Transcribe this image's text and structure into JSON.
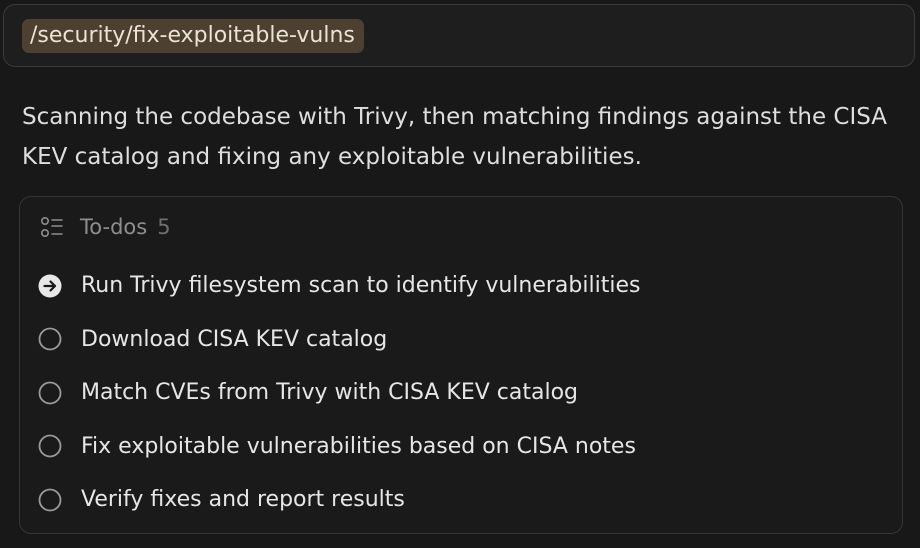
{
  "command": {
    "text": "/security/fix-exploitable-vulns"
  },
  "message": {
    "text": "Scanning the codebase with Trivy, then matching findings against the CISA KEV catalog and fixing any exploitable vulnerabilities."
  },
  "todos": {
    "title": "To-dos",
    "count": "5",
    "header_icon": "list-icon",
    "items": [
      {
        "label": "Run Trivy filesystem scan to identify vulnerabilities",
        "status": "in-progress",
        "icon": "arrow-right-circle-icon"
      },
      {
        "label": "Download CISA KEV catalog",
        "status": "pending",
        "icon": "empty-circle-icon"
      },
      {
        "label": "Match CVEs from Trivy with CISA KEV catalog",
        "status": "pending",
        "icon": "empty-circle-icon"
      },
      {
        "label": "Fix exploitable vulnerabilities based on CISA notes",
        "status": "pending",
        "icon": "empty-circle-icon"
      },
      {
        "label": "Verify fixes and report results",
        "status": "pending",
        "icon": "empty-circle-icon"
      }
    ]
  },
  "colors": {
    "background": "#181818",
    "command_chip": "#4d4030",
    "panel_border": "#353535",
    "active_icon": "#e8e8e8",
    "pending_icon": "#9a9a9a"
  }
}
